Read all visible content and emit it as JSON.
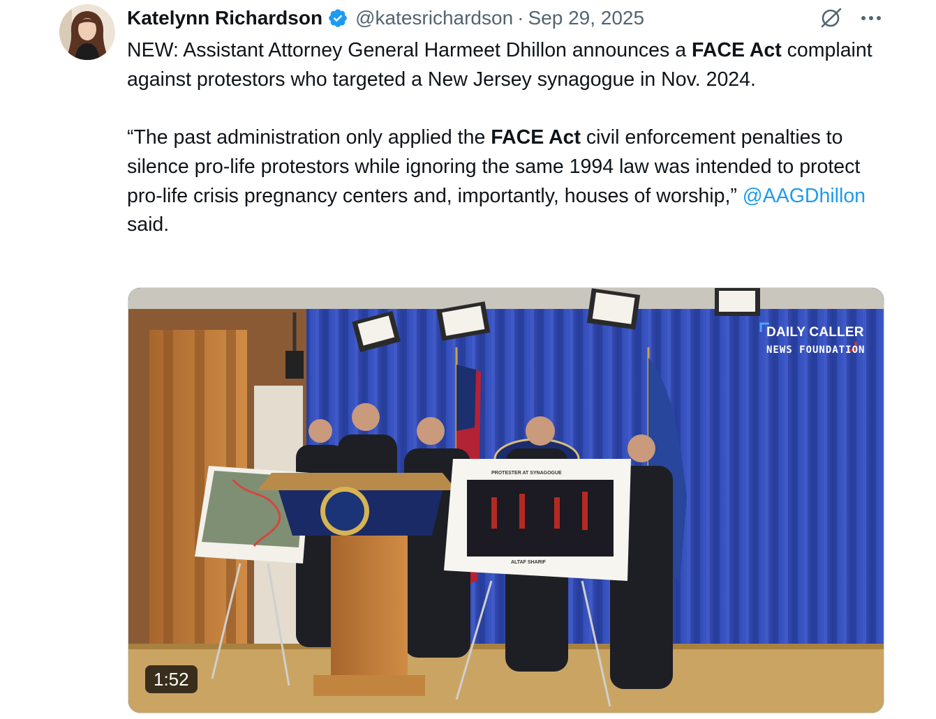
{
  "tweet": {
    "author_name": "Katelynn Richardson",
    "handle": "@katesrichardson",
    "separator": "·",
    "date": "Sep 29, 2025",
    "verified_color": "#1d9bf0",
    "body": {
      "p1_a": "NEW: Assistant Attorney General Harmeet Dhillon announces a ",
      "p1_bold": "FACE Act",
      "p1_b": " complaint against protestors who targeted a New Jersey synagogue in Nov. 2024.",
      "p2_a": "“The past administration only applied the ",
      "p2_bold": "FACE Act",
      "p2_b": " civil enforcement penalties to silence pro-life protestors while ignoring the same 1994 law was intended to protect pro-life crisis pregnancy centers and, importantly, houses of worship,” ",
      "p2_mention": "@AAGDhillon",
      "p2_c": " said."
    },
    "mention_color": "#1d9bf0"
  },
  "media": {
    "duration": "1:52",
    "watermark_line1": "DAILY CALLER",
    "watermark_line2": "NEWS FOUNDATION",
    "poster_title": "PROTESTER AT SYNAGOGUE",
    "poster_caption": "ALTAF SHARIF"
  },
  "icons": {
    "verified": "verified-badge-icon",
    "grok": "grok-icon",
    "more": "more-icon"
  }
}
